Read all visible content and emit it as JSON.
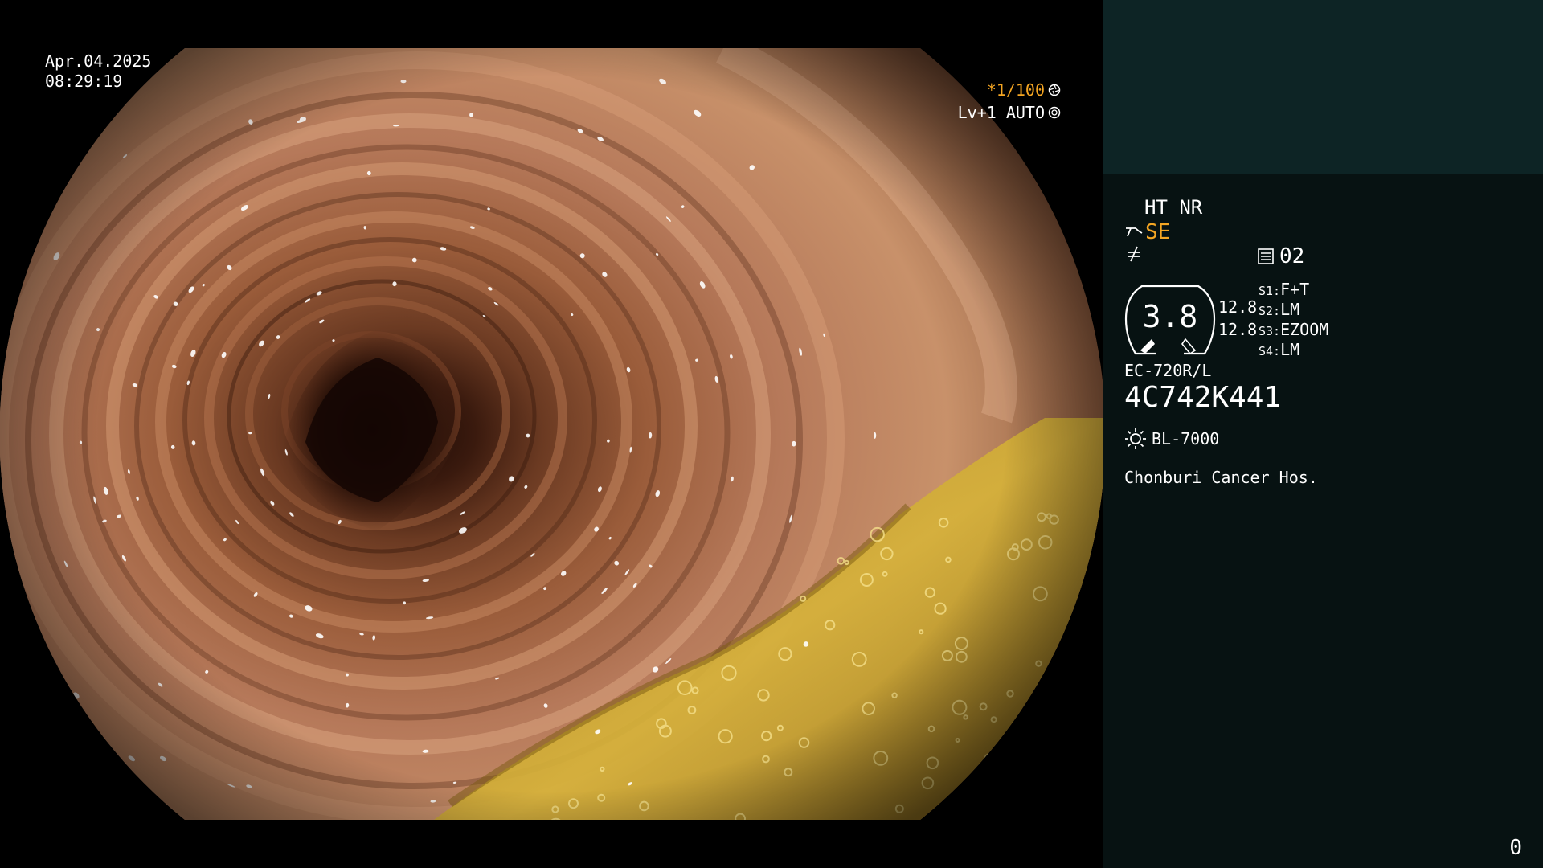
{
  "overlay": {
    "date": "Apr.04.2025",
    "time": "08:29:19",
    "shutter": "*1/100",
    "shutter_icon": "aperture-icon",
    "level": "Lv+1 AUTO",
    "level_icon": "iris-icon"
  },
  "panel": {
    "ht_nr": "HT NR",
    "se_label": "SE",
    "se_icon": "structure-enhance-icon",
    "slash_icon": "color-mode-icon",
    "channel_icon": "memory-card-icon",
    "channel": "02",
    "zoom_value": "3.8",
    "value_a": "12.8",
    "value_b": "12.8",
    "switches": [
      {
        "key": "S1:",
        "value": "F+T"
      },
      {
        "key": "S2:",
        "value": "LM"
      },
      {
        "key": "S3:",
        "value": "EZOOM"
      },
      {
        "key": "S4:",
        "value": "LM"
      }
    ],
    "scope_model": "EC-720R/L",
    "serial": "4C742K441",
    "light_icon": "light-source-icon",
    "light_source": "BL-7000",
    "hospital": "Chonburi Cancer Hos.",
    "counter": "0"
  },
  "colors": {
    "accent": "#f5a623",
    "panel_bg": "#071212",
    "thumb_bg": "#0d2425",
    "tissue_light": "#c8916a",
    "tissue_dark": "#6b3a22",
    "bile": "#c9a52c"
  }
}
